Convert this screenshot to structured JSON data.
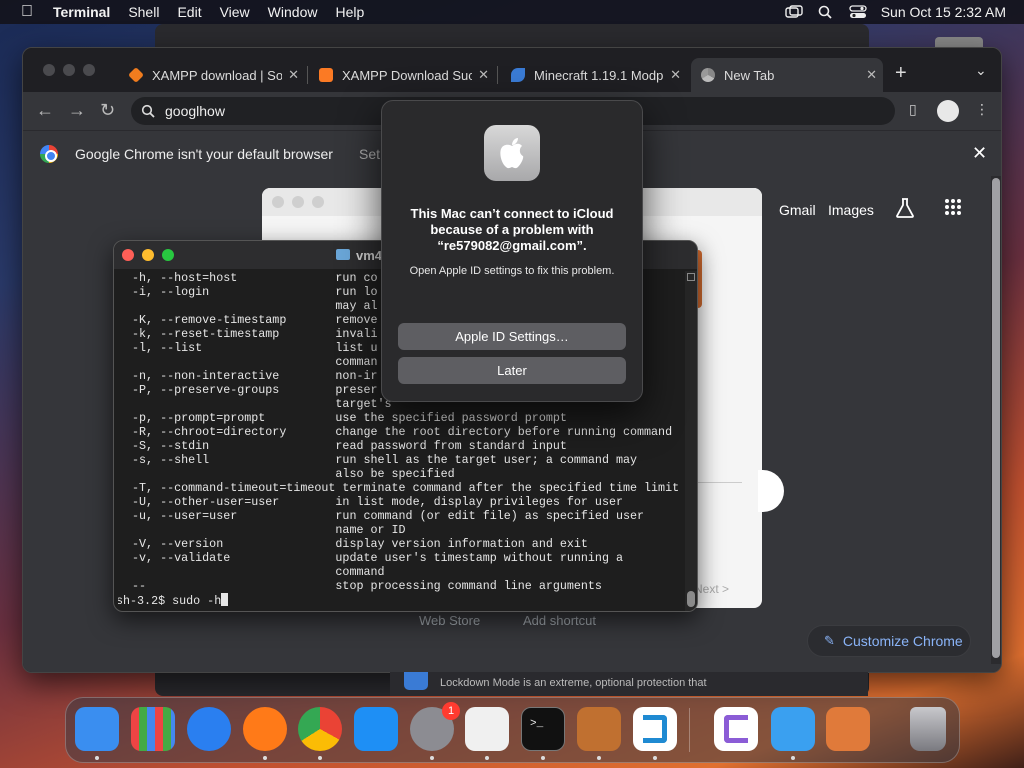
{
  "menubar": {
    "app": "Terminal",
    "items": [
      "Shell",
      "Edit",
      "View",
      "Window",
      "Help"
    ],
    "clock": "Sun Oct 15  2:32 AM"
  },
  "chrome": {
    "tabs": [
      {
        "title": "XAMPP download | So",
        "favicon_color": "#f07c1e"
      },
      {
        "title": "XAMPP Download Suc",
        "favicon_color": "#fb7a24"
      },
      {
        "title": "Minecraft 1.19.1 Modp",
        "favicon_color": "#3a7bd5"
      },
      {
        "title": "New Tab",
        "favicon_color": "#9aa0a6"
      }
    ],
    "omnibox_value": "googlhow",
    "infobar_message": "Google Chrome isn't your default browser",
    "infobar_action": "Set",
    "links": {
      "gmail": "Gmail",
      "images": "Images"
    },
    "shortcuts": [
      "Web Store",
      "Add shortcut"
    ],
    "customize": "Customize Chrome"
  },
  "settings_window": {
    "next": "Next >"
  },
  "terminal": {
    "title": "vm4",
    "lines": [
      "  -h, --host=host              run co",
      "  -i, --login                  run lo",
      "                               may al",
      "  -K, --remove-timestamp       remove",
      "  -k, --reset-timestamp        invali",
      "  -l, --list                   list u",
      "                               comman",
      "  -n, --non-interactive        non-ir",
      "  -P, --preserve-groups        preser",
      "                               target's",
      "  -p, --prompt=prompt          use the specified password prompt",
      "  -R, --chroot=directory       change the root directory before running command",
      "  -S, --stdin                  read password from standard input",
      "  -s, --shell                  run shell as the target user; a command may",
      "                               also be specified",
      "  -T, --command-timeout=timeout terminate command after the specified time limit",
      "  -U, --other-user=user        in list mode, display privileges for user",
      "  -u, --user=user              run command (or edit file) as specified user",
      "                               name or ID",
      "  -V, --version                display version information and exit",
      "  -v, --validate               update user's timestamp without running a",
      "                               command",
      "  --                           stop processing command line arguments"
    ],
    "prompt": "sh-3.2$ sudo -h"
  },
  "alert": {
    "title": "This Mac can’t connect to iCloud because of a problem with “re579082@gmail.com”.",
    "body": "Open Apple ID settings to fix this problem.",
    "primary_button": "Apple ID Settings…",
    "secondary_button": "Later"
  },
  "bottom_strip": {
    "text": "Lockdown Mode is an extreme, optional protection that"
  },
  "dock": {
    "apps": [
      {
        "name": "finder",
        "color": "#3a8ef0"
      },
      {
        "name": "launchpad",
        "color": "#d8d8e0"
      },
      {
        "name": "safari",
        "color": "#2a7ff0"
      },
      {
        "name": "firefox",
        "color": "#ff7a18"
      },
      {
        "name": "chrome",
        "color": "#ffffff"
      },
      {
        "name": "app-store",
        "color": "#1e8ff5"
      },
      {
        "name": "system-settings",
        "color": "#8c8c92"
      },
      {
        "name": "textedit",
        "color": "#f0f0f0"
      },
      {
        "name": "terminal",
        "color": "#111111"
      },
      {
        "name": "garageband",
        "color": "#c07030"
      },
      {
        "name": "vscode",
        "color": "#ffffff"
      },
      {
        "name": "visual-studio",
        "color": "#ffffff"
      },
      {
        "name": "weather",
        "color": "#3aa0f0"
      },
      {
        "name": "xampp",
        "color": "#e07a3a"
      },
      {
        "name": "trash",
        "color": "#9a9aa0"
      }
    ],
    "settings_badge": "1"
  }
}
